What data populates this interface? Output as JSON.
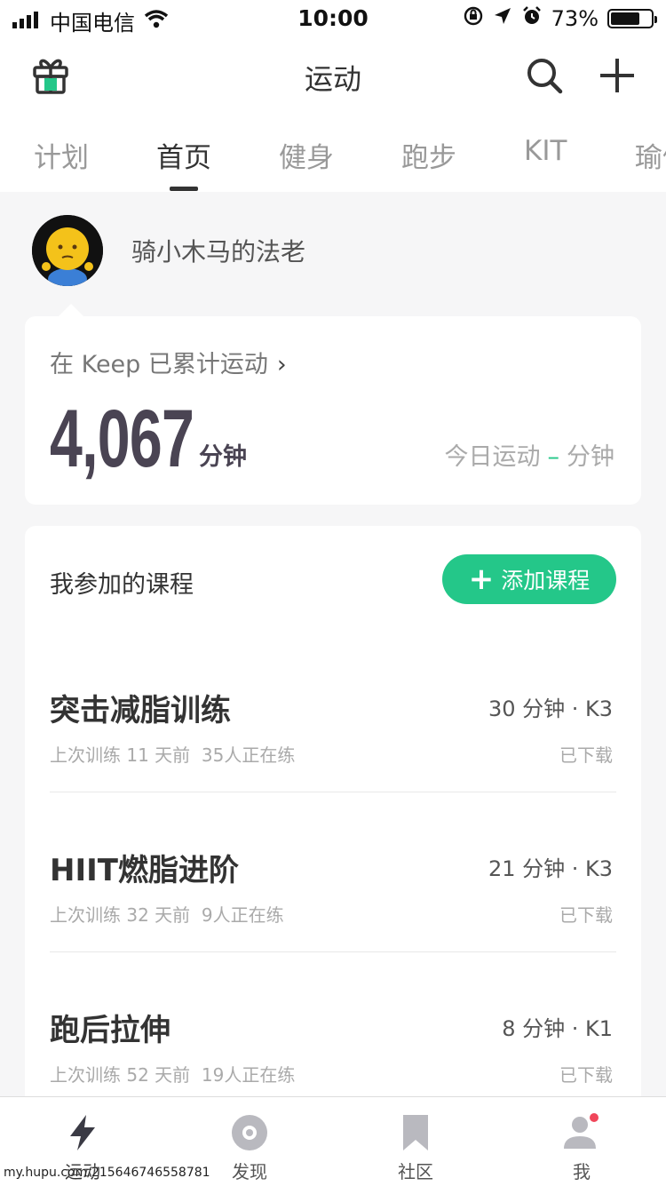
{
  "status_bar": {
    "carrier": "中国电信",
    "time": "10:00",
    "battery_percent": "73%",
    "battery_level": 0.73
  },
  "nav": {
    "title": "运动",
    "left_icon": "gift-icon",
    "right_icons": [
      "search-icon",
      "plus-icon"
    ]
  },
  "tabs": [
    {
      "label": "计划",
      "active": false
    },
    {
      "label": "首页",
      "active": true
    },
    {
      "label": "健身",
      "active": false
    },
    {
      "label": "跑步",
      "active": false
    },
    {
      "label": "KIT",
      "active": false
    },
    {
      "label": "瑜伽",
      "active": false
    }
  ],
  "profile": {
    "name": "骑小木马的法老"
  },
  "stats": {
    "label": "在 Keep 已累计运动",
    "total": "4,067",
    "unit": "分钟",
    "today_label": "今日运动",
    "today_value": "–",
    "today_unit": "分钟"
  },
  "courses": {
    "title": "我参加的课程",
    "add_label": "添加课程",
    "items": [
      {
        "name": "突击减脂训练",
        "meta": "30 分钟 · K3",
        "last": "上次训练 11 天前",
        "active": "35人正在练",
        "status": "已下载"
      },
      {
        "name": "HIIT燃脂进阶",
        "meta": "21 分钟 · K3",
        "last": "上次训练 32 天前",
        "active": "9人正在练",
        "status": "已下载"
      },
      {
        "name": "跑后拉伸",
        "meta": "8 分钟 · K1",
        "last": "上次训练 52 天前",
        "active": "19人正在练",
        "status": "已下载"
      }
    ]
  },
  "tab_bar": [
    {
      "label": "运动",
      "icon": "lightning-icon",
      "active": true
    },
    {
      "label": "发现",
      "icon": "discover-icon",
      "active": false
    },
    {
      "label": "社区",
      "icon": "bookmark-icon",
      "active": false
    },
    {
      "label": "我",
      "icon": "user-icon",
      "active": false,
      "badge": true
    }
  ],
  "colors": {
    "accent": "#24c789",
    "stats_text": "#4a4453",
    "badge": "#f0465a"
  },
  "watermark": "my.hupu.com/215646746558781"
}
